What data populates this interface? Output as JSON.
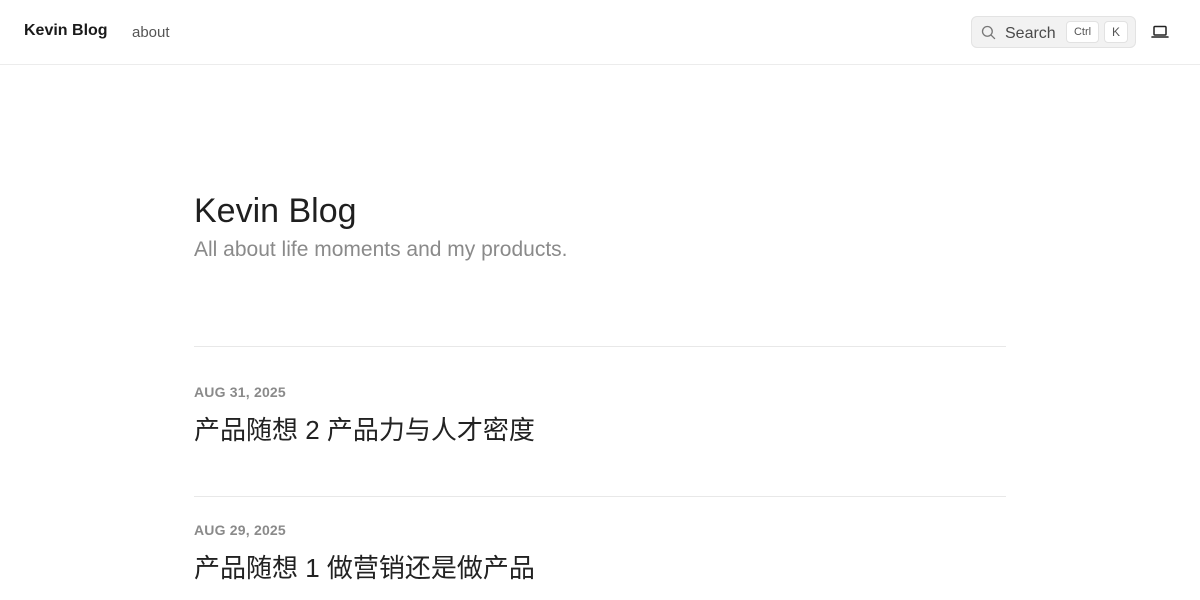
{
  "header": {
    "brand": "Kevin Blog",
    "nav": [
      {
        "label": "about"
      }
    ],
    "search": {
      "label": "Search",
      "shortcut": [
        "Ctrl",
        "K"
      ]
    },
    "theme_toggle_icon": "laptop-icon"
  },
  "hero": {
    "title": "Kevin Blog",
    "subtitle": "All about life moments and my products."
  },
  "posts": [
    {
      "date": "AUG 31, 2025",
      "title": "产品随想 2 产品力与人才密度"
    },
    {
      "date": "AUG 29, 2025",
      "title": "产品随想 1 做营销还是做产品"
    }
  ],
  "colors": {
    "text": "#222222",
    "muted": "#8a8a8a",
    "border": "#e8e8e8",
    "search_bg": "#f2f2f2"
  }
}
